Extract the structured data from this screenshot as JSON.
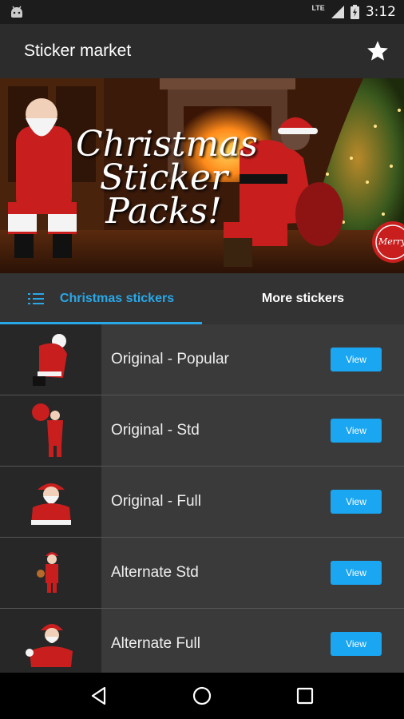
{
  "status_bar": {
    "network": "LTE",
    "time": "3:12",
    "icons": [
      "android-icon",
      "signal-icon",
      "battery-icon"
    ]
  },
  "app_bar": {
    "title": "Sticker market",
    "action_icon": "star-icon"
  },
  "banner": {
    "text_line1": "Christmas",
    "text_line2": "Sticker",
    "text_line3": "Packs!",
    "corner_text": "Merry"
  },
  "tabs": [
    {
      "label": "Christmas stickers",
      "active": true,
      "icon": "list-icon"
    },
    {
      "label": "More stickers",
      "active": false
    }
  ],
  "colors": {
    "accent": "#29a8e8",
    "button": "#1aa6f0",
    "santa_red": "#c81e1e"
  },
  "packs": [
    {
      "name": "Original - Popular",
      "button": "View"
    },
    {
      "name": "Original - Std",
      "button": "View"
    },
    {
      "name": "Original - Full",
      "button": "View"
    },
    {
      "name": "Alternate Std",
      "button": "View"
    },
    {
      "name": "Alternate Full",
      "button": "View"
    }
  ],
  "nav_bar": {
    "icons": [
      "back-icon",
      "home-icon",
      "recents-icon"
    ]
  }
}
